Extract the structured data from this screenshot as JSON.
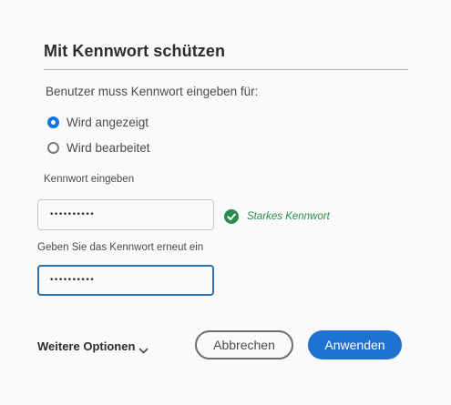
{
  "dialog": {
    "title": "Mit Kennwort schützen",
    "intro": "Benutzer muss Kennwort eingeben für:"
  },
  "options": {
    "viewed": {
      "label": "Wird angezeigt",
      "selected": true
    },
    "edited": {
      "label": "Wird bearbeitet",
      "selected": false
    }
  },
  "password": {
    "label": "Kennwort eingeben",
    "value": "••••••••••",
    "strength_text": "Starkes Kennwort",
    "strength_icon": "check-circle-icon"
  },
  "confirm": {
    "label": "Geben Sie das Kennwort erneut ein",
    "value": "••••••••••"
  },
  "footer": {
    "more_options": "Weitere Optionen",
    "cancel_label": "Abbrechen",
    "apply_label": "Anwenden"
  },
  "colors": {
    "accent": "#1473e6",
    "apply_button": "#1e72d1",
    "focus_border": "#2b6fb5",
    "success": "#2d8a4e"
  }
}
